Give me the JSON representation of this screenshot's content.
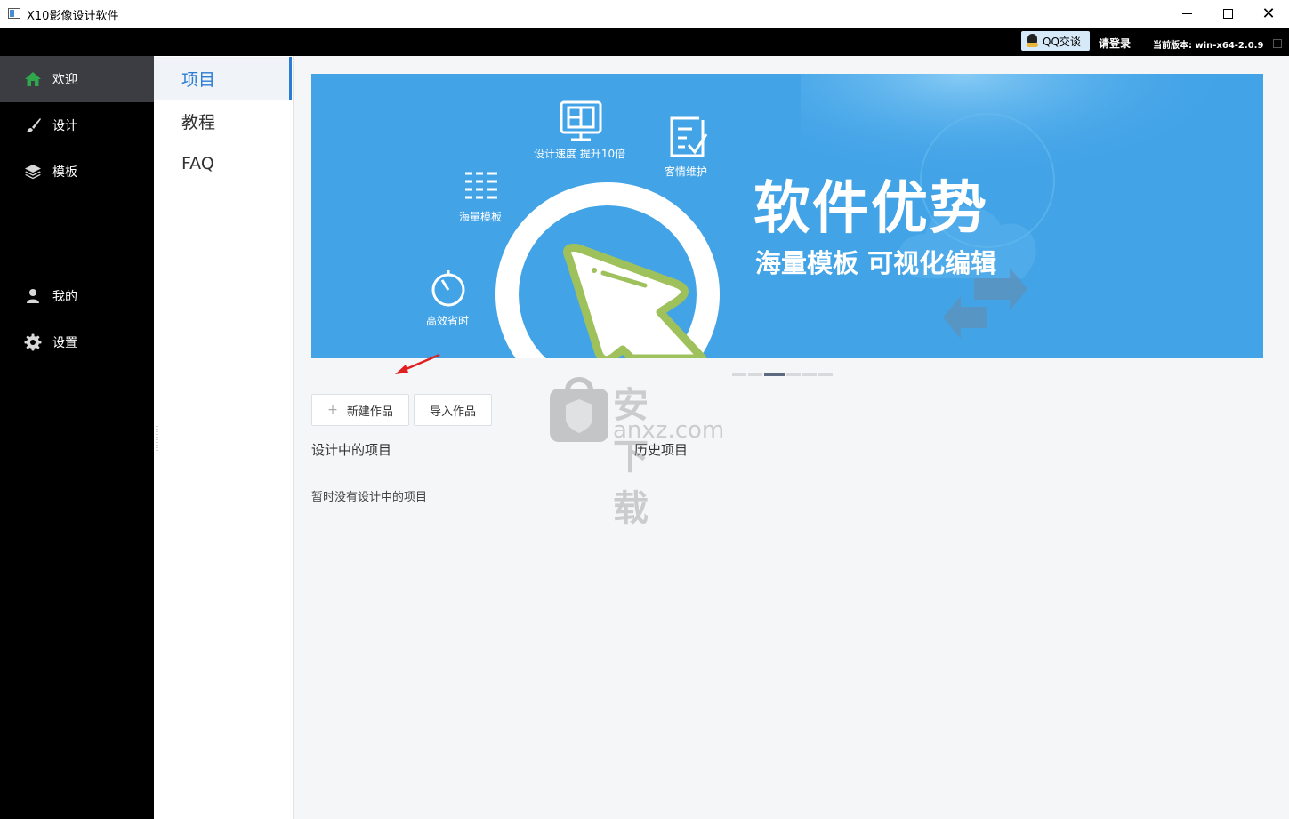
{
  "window": {
    "title": "X10影像设计软件"
  },
  "topbar": {
    "qq_label": "QQ交谈",
    "login_label": "请登录",
    "version_label": "当前版本: win-x64-2.0.9"
  },
  "leftnav": {
    "items": [
      {
        "label": "欢迎",
        "icon": "home-icon"
      },
      {
        "label": "设计",
        "icon": "brush-icon"
      },
      {
        "label": "模板",
        "icon": "layers-icon"
      },
      {
        "label": "我的",
        "icon": "user-icon"
      },
      {
        "label": "设置",
        "icon": "gear-icon"
      }
    ]
  },
  "subnav": {
    "items": [
      {
        "label": "项目"
      },
      {
        "label": "教程"
      },
      {
        "label": "FAQ"
      }
    ]
  },
  "banner": {
    "title": "软件优势",
    "subtitle": "海量模板 可视化编辑",
    "features": [
      {
        "label": "设计速度 提升10倍",
        "icon": "monitor-icon"
      },
      {
        "label": "客情维护",
        "icon": "checklist-icon"
      },
      {
        "label": "海量模板",
        "icon": "grid-icon"
      },
      {
        "label": "高效省时",
        "icon": "stopwatch-icon"
      }
    ],
    "carousel_count": 6,
    "carousel_active": 3
  },
  "actions": {
    "new_label": "新建作品",
    "import_label": "导入作品"
  },
  "sections": {
    "in_progress_title": "设计中的项目",
    "history_title": "历史项目",
    "empty_text": "暂时没有设计中的项目"
  },
  "watermark": {
    "text": "安下载",
    "url": "anxz.com"
  },
  "colors": {
    "accent": "#2b7cd3",
    "banner_bg": "#42a3e7",
    "nav_bg": "#000000",
    "nav_active": "#3b3d42",
    "annotation_arrow": "#e02020"
  }
}
